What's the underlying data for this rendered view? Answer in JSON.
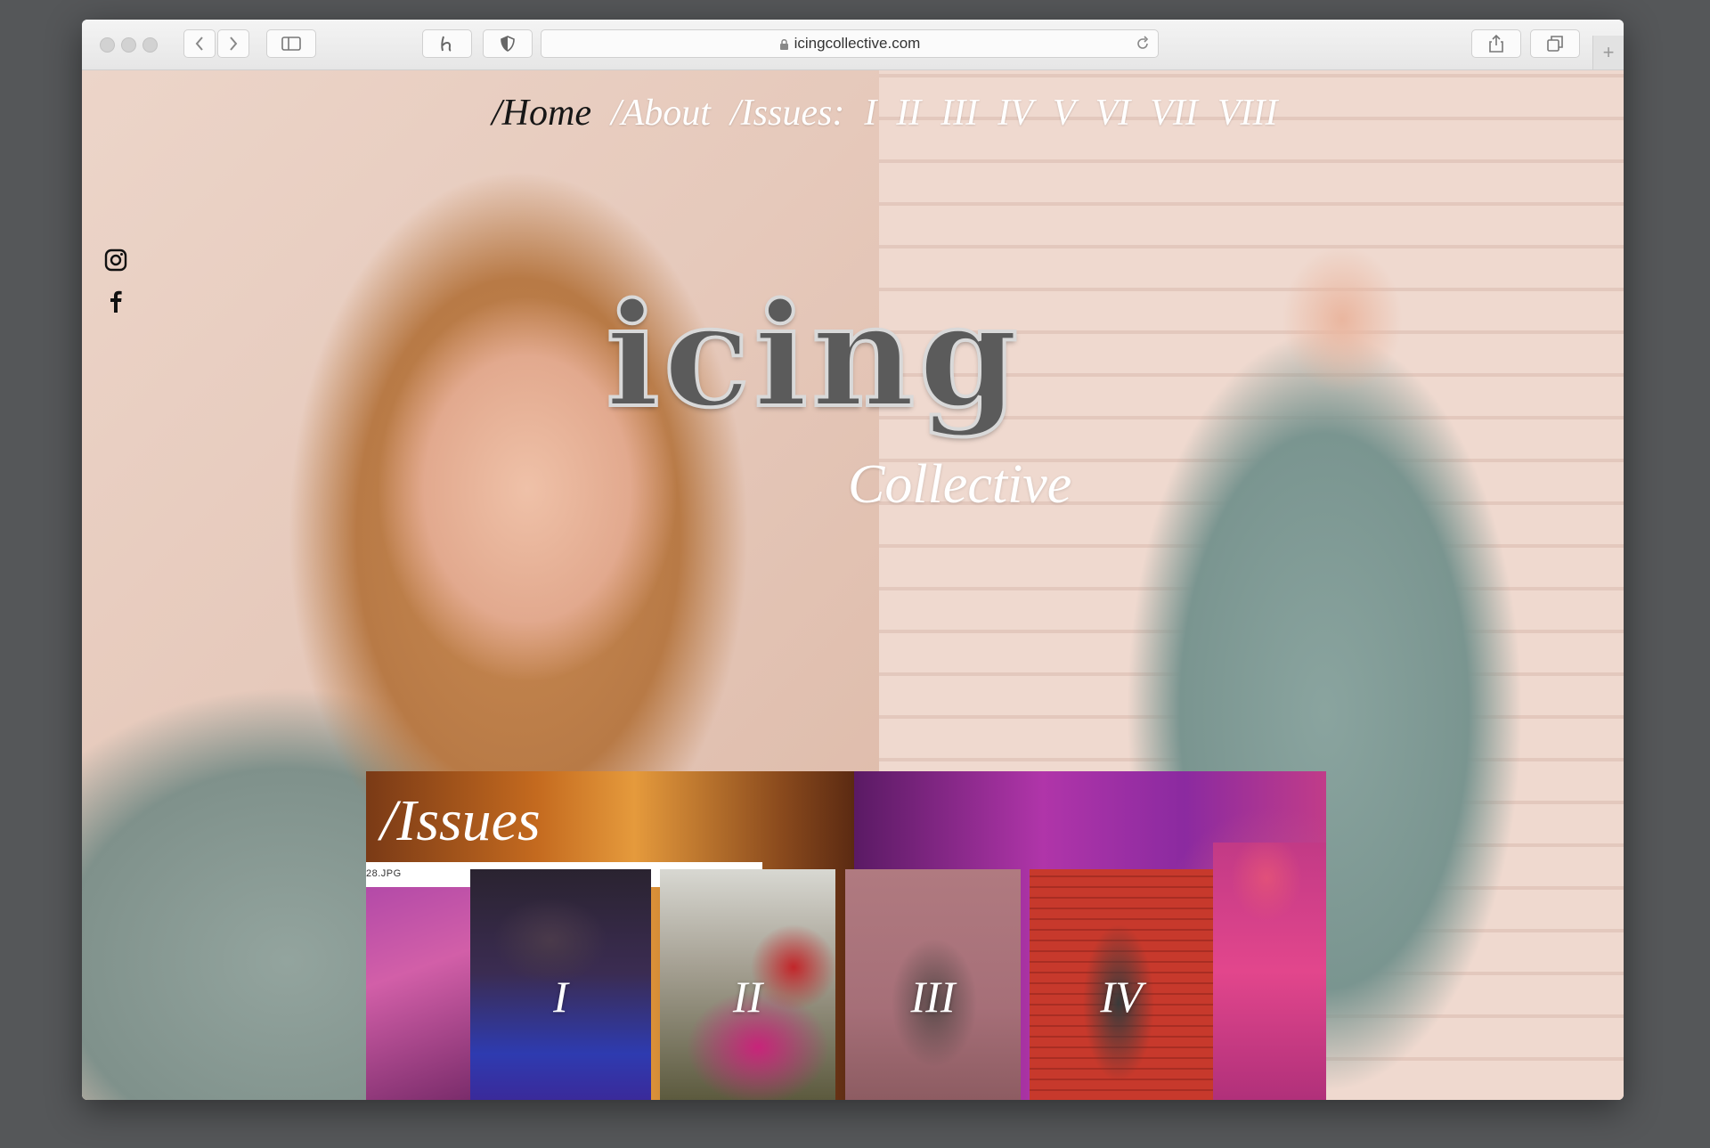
{
  "browser": {
    "url": "icingcollective.com"
  },
  "nav": {
    "home": "/Home",
    "about": "/About",
    "issues": "/Issues:",
    "issue_links": [
      "I",
      "II",
      "III",
      "IV",
      "V",
      "VI",
      "VII",
      "VIII"
    ]
  },
  "social": {
    "instagram_icon": "instagram-icon",
    "facebook_icon": "facebook-icon"
  },
  "hero": {
    "logo_text": "icing",
    "subtitle": "Collective"
  },
  "issues": {
    "title": "/Issues",
    "file_label": "28.JPG",
    "tiles": [
      "I",
      "II",
      "III",
      "IV"
    ]
  },
  "colors": {
    "background": "#555759",
    "nav_active": "#161616",
    "nav_text": "#ffffff"
  }
}
